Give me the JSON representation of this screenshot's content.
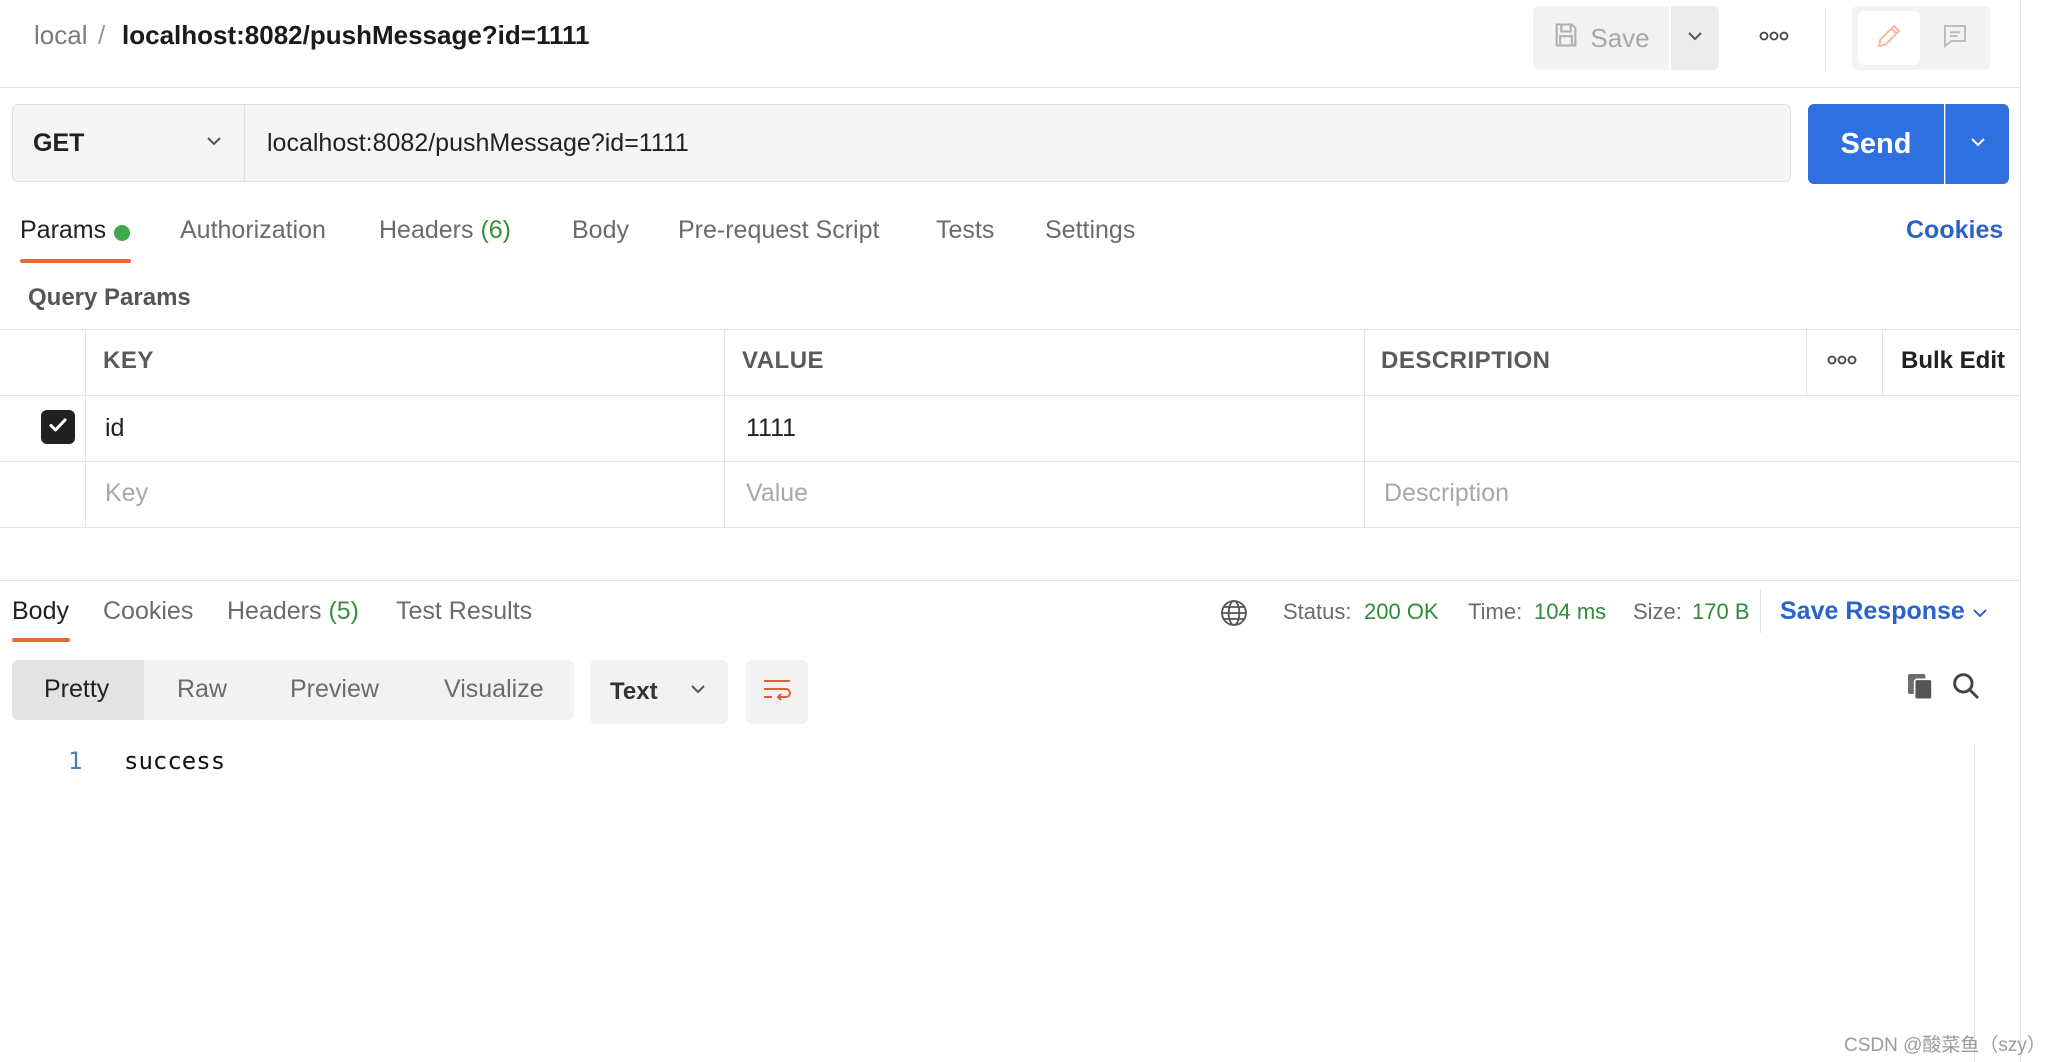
{
  "header": {
    "breadcrumb_parent": "local",
    "breadcrumb_separator": "/",
    "request_name": "localhost:8082/pushMessage?id=1111",
    "save_label": "Save"
  },
  "request": {
    "method": "GET",
    "url": "localhost:8082/pushMessage?id=1111",
    "send_label": "Send"
  },
  "request_tabs": {
    "params": "Params",
    "authorization": "Authorization",
    "headers": "Headers",
    "headers_count": "(6)",
    "body": "Body",
    "pre_request_script": "Pre-request Script",
    "tests": "Tests",
    "settings": "Settings",
    "cookies": "Cookies"
  },
  "query_params": {
    "title": "Query Params",
    "columns": {
      "key": "KEY",
      "value": "VALUE",
      "description": "DESCRIPTION"
    },
    "bulk_edit": "Bulk Edit",
    "rows": [
      {
        "key": "id",
        "value": "1111",
        "description": "",
        "checked": true
      }
    ],
    "placeholders": {
      "key": "Key",
      "value": "Value",
      "description": "Description"
    }
  },
  "response": {
    "tabs": {
      "body": "Body",
      "cookies": "Cookies",
      "headers": "Headers",
      "headers_count": "(5)",
      "test_results": "Test Results"
    },
    "status_label": "Status:",
    "status_value": "200 OK",
    "time_label": "Time:",
    "time_value": "104 ms",
    "size_label": "Size:",
    "size_value": "170 B",
    "save_response": "Save Response",
    "view_modes": [
      "Pretty",
      "Raw",
      "Preview",
      "Visualize"
    ],
    "active_view_mode": "Pretty",
    "format": "Text",
    "body_lines": [
      {
        "number": "1",
        "text": "success"
      }
    ]
  },
  "watermark": "CSDN @酸菜鱼（szy）",
  "colors": {
    "accent_orange": "#e8693a",
    "send_blue": "#2f6fdf",
    "link_blue": "#2a63c9",
    "status_green": "#2f8a3a"
  }
}
